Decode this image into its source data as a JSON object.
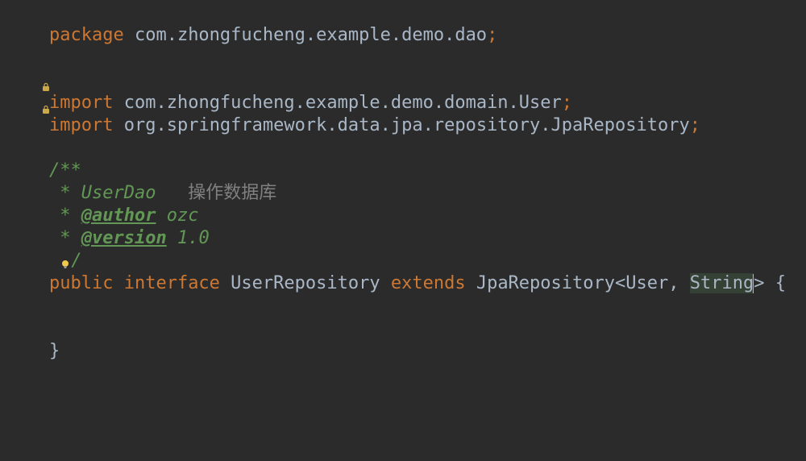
{
  "code": {
    "line1": {
      "package_kw": "package",
      "package_name": " com.zhongfucheng.example.demo.dao",
      "semi": ";"
    },
    "line3": {
      "import_kw": "import",
      "path": " com.zhongfucheng.example.demo.domain.User",
      "semi": ";"
    },
    "line4": {
      "import_kw": "import",
      "path": " org.springframework.data.jpa.repository.JpaRepository",
      "semi": ";"
    },
    "javadoc": {
      "open": "/**",
      "line2_star": " * ",
      "line2_name": "UserDao",
      "line2_desc": "   操作数据库",
      "line3_star": " * ",
      "line3_tag": "@author",
      "line3_val": " ozc",
      "line4_star": " * ",
      "line4_tag": "@version",
      "line4_val": " 1.0",
      "close_star": " ",
      "close": "/"
    },
    "decl": {
      "public_kw": "public ",
      "interface_kw": "interface",
      "name": " UserRepository ",
      "extends_kw": "extends",
      "parent": " JpaRepository",
      "lt": "<",
      "type1": "User",
      "comma": ", ",
      "type2": "String",
      "gt": ">",
      "space_brace": " {"
    },
    "close_brace": "}"
  },
  "icons": {
    "lock": "lock-icon",
    "bulb": "bulb-icon"
  }
}
